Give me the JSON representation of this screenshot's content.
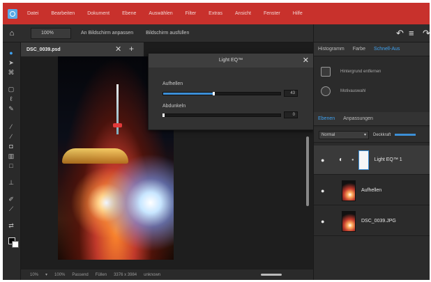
{
  "menubar": {
    "items": [
      "Datei",
      "Bearbeiten",
      "Dokument",
      "Ebene",
      "Auswählen",
      "Filter",
      "Extras",
      "Ansicht",
      "Fenster",
      "Hilfe"
    ]
  },
  "options_bar": {
    "zoom_value": "100%",
    "fit_screen_label": "An Bildschirm anpassen",
    "fill_screen_label": "Bildschirm ausfüllen"
  },
  "document": {
    "tab_title": "DSC_0039.psd",
    "status": [
      "10%",
      "▾",
      "100%",
      "Passend",
      "Füllen",
      "3376 x 3984",
      "unknown"
    ]
  },
  "dialog": {
    "title": "Light EQ™",
    "sliders": [
      {
        "label": "Aufhellen",
        "value": "43",
        "level": 0.43
      },
      {
        "label": "Abdunkeln",
        "value": "0",
        "level": 0.0
      }
    ]
  },
  "panel_tabs": {
    "items": [
      "Histogramm",
      "Farbe",
      "Schnell-Aus"
    ],
    "active_index": 2
  },
  "quick_actions": {
    "items": [
      {
        "label": "Hintergrund entfernen",
        "icon": "circle-icon"
      },
      {
        "label": "Motivauswahl",
        "icon": "cursor-select-icon"
      }
    ]
  },
  "layers_tabs": {
    "items": [
      "Ebenen",
      "Anpassungen"
    ],
    "active_index": 0
  },
  "layers": {
    "blend_mode": "Normal",
    "opacity_label": "Deckkraft",
    "items": [
      {
        "name": "Light EQ™ 1",
        "selected": true,
        "type": "adjustment"
      },
      {
        "name": "Aufhellen",
        "selected": false,
        "type": "image"
      },
      {
        "name": "DSC_0039.JPG",
        "selected": false,
        "type": "image"
      }
    ]
  },
  "colors": {
    "menu_bar": "#c8312c",
    "accent": "#3fa2f0",
    "slider_fill": "#3c8fd6",
    "panel_bg": "#2b2b2b"
  }
}
